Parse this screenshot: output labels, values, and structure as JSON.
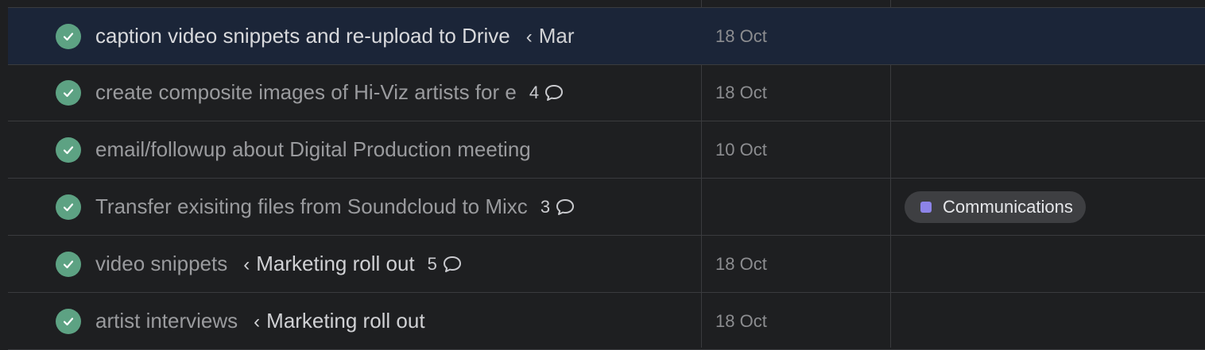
{
  "colors": {
    "check": "#5da283",
    "selected_row": "#1b2538",
    "tag_communications": "#8d84e8"
  },
  "rows": [
    {
      "name": "caption video snippets and re-upload to Drive",
      "parent": "Mar",
      "comments": "",
      "due": "18 Oct",
      "tag": "",
      "selected": true
    },
    {
      "name": "create composite images of Hi-Viz artists for e",
      "parent": "",
      "comments": "4",
      "due": "18 Oct",
      "tag": ""
    },
    {
      "name": "email/followup about Digital Production meeting",
      "parent": "",
      "comments": "",
      "due": "10 Oct",
      "tag": ""
    },
    {
      "name": "Transfer exisiting files from Soundcloud to Mixc",
      "parent": "",
      "comments": "3",
      "due": "",
      "tag": "Communications"
    },
    {
      "name": "video snippets",
      "parent": "Marketing roll out",
      "comments": "5",
      "due": "18 Oct",
      "tag": ""
    },
    {
      "name": "artist interviews",
      "parent": "Marketing roll out",
      "comments": "",
      "due": "18 Oct",
      "tag": ""
    }
  ]
}
